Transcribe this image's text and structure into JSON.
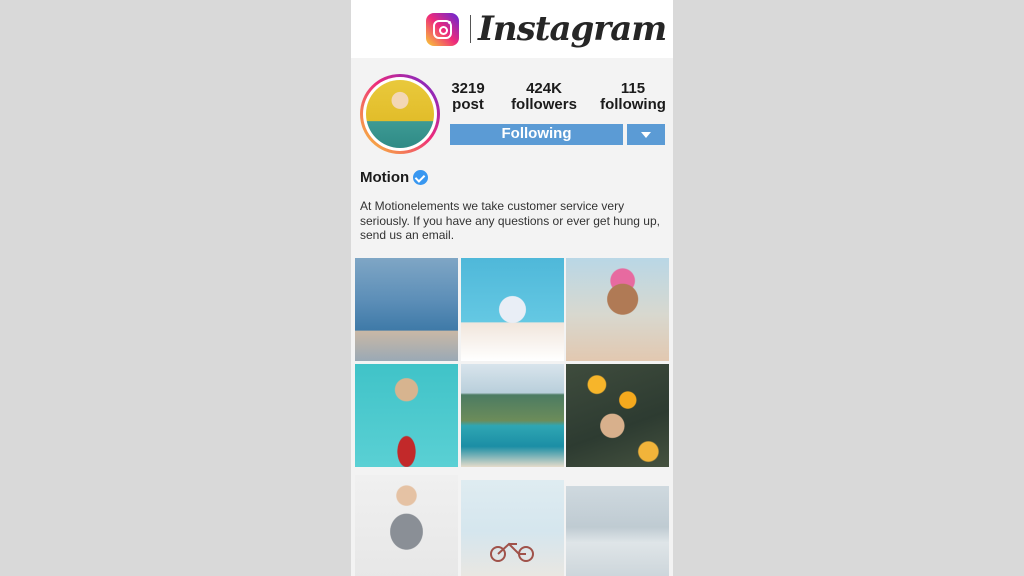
{
  "header": {
    "brand": "Instagram"
  },
  "profile": {
    "stats": [
      {
        "value": "3219",
        "label": "post"
      },
      {
        "value": "424K",
        "label": "followers"
      },
      {
        "value": "115",
        "label": "following"
      }
    ],
    "follow_button": "Following",
    "username": "Motion",
    "bio": "At Motionelements we take customer service very seriously. If you have any questions or ever get hung up, send us an email."
  },
  "grid": {
    "items": [
      "photo-1",
      "photo-2",
      "photo-3",
      "photo-4",
      "photo-5",
      "photo-6",
      "photo-7",
      "photo-8",
      "photo-9"
    ]
  },
  "colors": {
    "accent": "#5b9bd5",
    "verified": "#3897f0",
    "background": "#d9d9d9",
    "panel": "#f3f3f3"
  }
}
